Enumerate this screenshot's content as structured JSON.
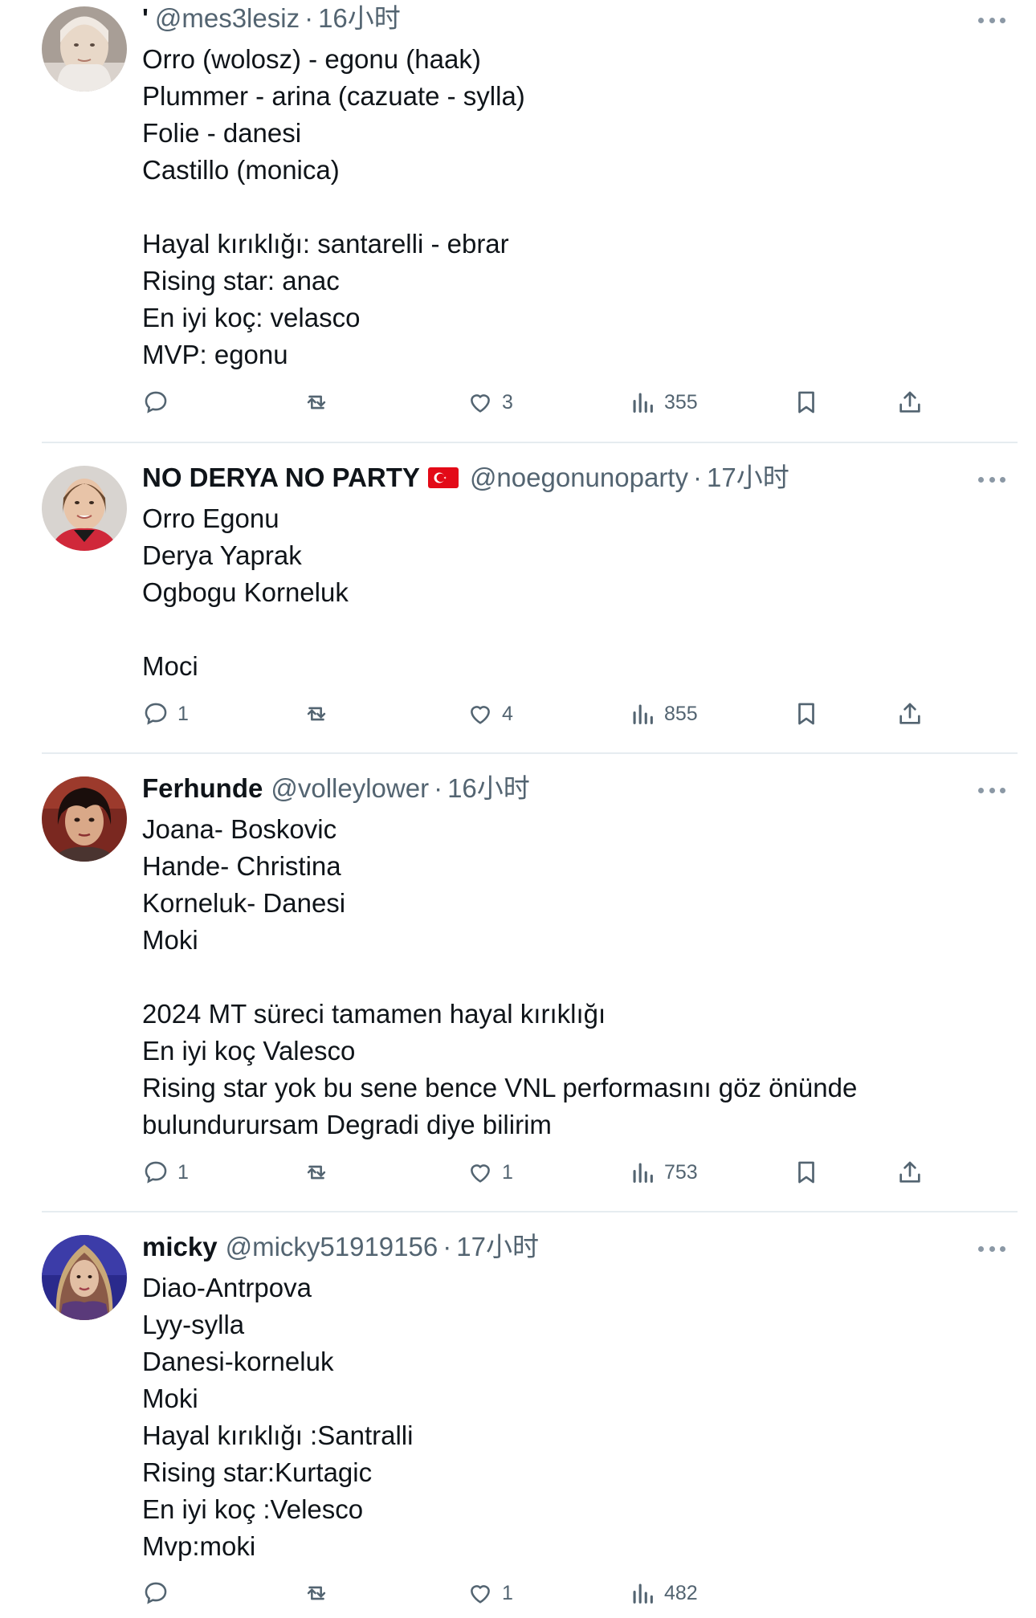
{
  "posts": [
    {
      "prefix": "'",
      "display_name": "",
      "handle": "@mes3lesiz",
      "dot": "·",
      "time": "16小时",
      "has_flag": false,
      "lines": [
        "Orro (wolosz) - egonu (haak)",
        "Plummer - arina (cazuate - sylla)",
        "Folie - danesi",
        "Castillo (monica)",
        "",
        "Hayal kırıklığı: santarelli - ebrar",
        "Rising star: anac",
        "En iyi koç: velasco",
        "MVP: egonu"
      ],
      "replies": "",
      "reposts": "",
      "likes": "3",
      "views": "355"
    },
    {
      "prefix": "",
      "display_name": "NO DERYA NO PARTY",
      "handle": "@noegonunoparty",
      "dot": "·",
      "time": "17小时",
      "has_flag": true,
      "lines": [
        "Orro Egonu",
        "Derya Yaprak",
        "Ogbogu Korneluk",
        "",
        "Moci"
      ],
      "replies": "1",
      "reposts": "",
      "likes": "4",
      "views": "855"
    },
    {
      "prefix": "",
      "display_name": "Ferhunde",
      "handle": "@volleylower",
      "dot": "·",
      "time": "16小时",
      "has_flag": false,
      "lines": [
        "Joana- Boskovic",
        "Hande- Christina",
        "Korneluk- Danesi",
        "Moki",
        "",
        "2024 MT süreci tamamen hayal kırıklığı",
        "En iyi koç Valesco",
        "Rising star yok bu sene bence VNL performasını göz önünde",
        "bulundurursam Degradi diye bilirim"
      ],
      "replies": "1",
      "reposts": "",
      "likes": "1",
      "views": "753"
    },
    {
      "prefix": "",
      "display_name": "micky",
      "handle": "@micky51919156",
      "dot": "·",
      "time": "17小时",
      "has_flag": false,
      "lines": [
        "Diao-Antrpova",
        "Lyy-sylla",
        "Danesi-korneluk",
        "Moki",
        "Hayal kırıklığı :Santralli",
        "Rising star:Kurtagic",
        "En iyi koç :Velesco",
        "Mvp:moki"
      ],
      "replies": "",
      "reposts": "",
      "likes": "1",
      "views": "482"
    }
  ],
  "icons": {
    "reply": "reply-icon",
    "repost": "repost-icon",
    "like": "heart-icon",
    "views": "views-icon",
    "bookmark": "bookmark-icon",
    "share": "share-icon",
    "more": "more-icon"
  },
  "colors": {
    "text": "#0f1419",
    "secondary": "#536471",
    "divider": "#e6ecf0",
    "flag_red": "#e30a17"
  }
}
